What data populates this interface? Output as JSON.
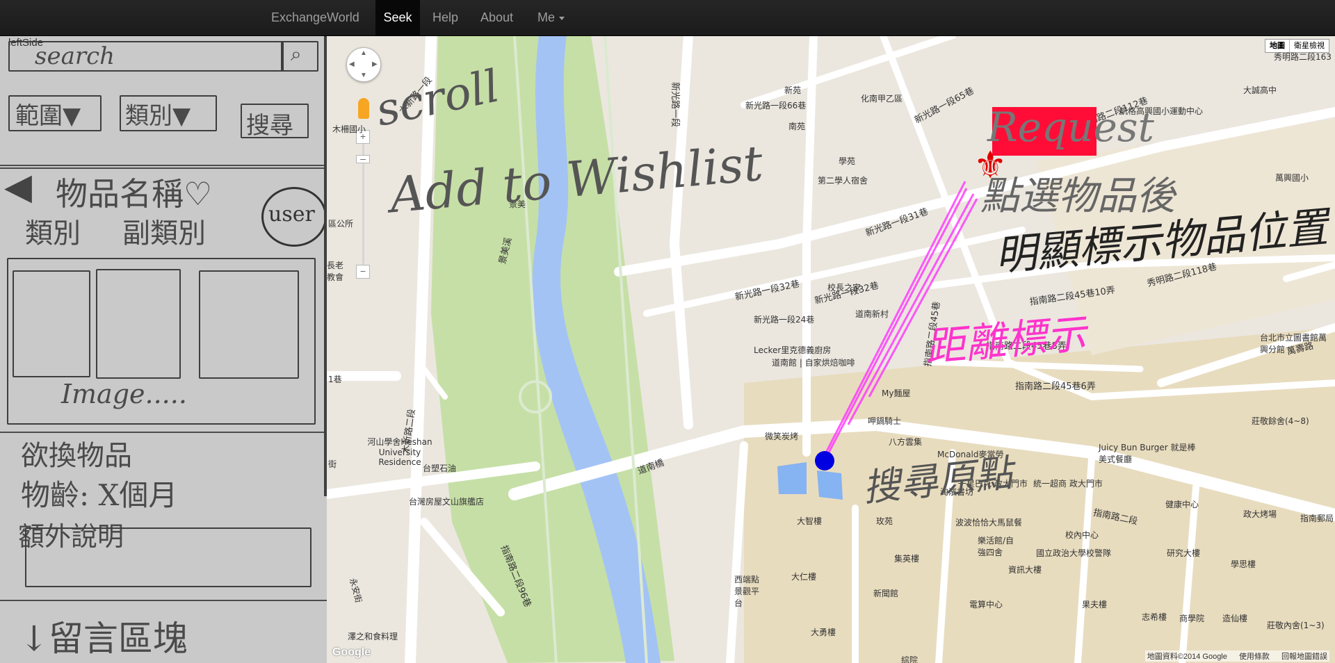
{
  "navbar": {
    "brand": "ExchangeWorld",
    "items": [
      "Seek",
      "Help",
      "About",
      "Me"
    ],
    "active": "Seek"
  },
  "left_panel": {
    "label": "leftSide",
    "search_placeholder": "search",
    "filters": [
      "範圍▼",
      "類別▼",
      "搜尋"
    ],
    "item_name": "物品名稱♡",
    "category": "類別",
    "sub_category": "副類別",
    "user": "user",
    "images_label": "Image.....",
    "want_label": "欲換物品",
    "age_label": "物齡: X個月",
    "extra_label": "額外說明",
    "comment_label": "↓留言區塊"
  },
  "map": {
    "map_type": [
      "地圖",
      "衛星檢視"
    ],
    "attribution": [
      "地圖資料©2014 Google",
      "使用條款",
      "回報地圖錯誤"
    ],
    "logo": "Google",
    "places": [
      "新光路一段65巷",
      "新光路一段66巷",
      "化南甲乙區",
      "南苑",
      "新苑",
      "第二學人宿舍",
      "學苑",
      "新光路一段31巷",
      "新光路一段32巷",
      "新光路一段24巷",
      "校長之家",
      "道南新村",
      "Lecker里克德義廚房",
      "道南館 | 自家烘焙咖啡",
      "My麵屋",
      "呷鍋騎士",
      "八方雲集",
      "McDonald麥當勞",
      "微笑炭烤",
      "道南橋",
      "河山學舍Heshan University Residence",
      "台塑石油",
      "台灣房屋文山旗艦店",
      "指南路二段96巷",
      "永安街",
      "澤之和食料理",
      "大智樓",
      "玫苑",
      "集英樓",
      "大仁樓",
      "新聞館",
      "西端點景觀平台",
      "大勇樓",
      "綜院",
      "資訊大樓",
      "電算中心",
      "果夫樓",
      "志希樓",
      "商學院",
      "造仙樓",
      "研究大樓",
      "學思樓",
      "政大烤場",
      "指南郵局",
      "健康中心",
      "國立政治大學校警隊",
      "樂活館/自強四舍",
      "波波恰恰大馬鼠餐",
      "統一超商 政大門市",
      "一星巴克 政大門市",
      "Juicy Bun Burger 就是棒美式餐廳",
      "莊敬餘舍(4~8)",
      "台北市立圖書館萬興分館",
      "萬壽路",
      "萬興國小",
      "凱格高興國小運動中心",
      "大誠高中",
      "秀明路二段163",
      "秀明路二段118巷",
      "秀明路二段112巷",
      "指南路二段45巷10弄",
      "指南路二段45巷8弄",
      "指南路二段45巷6弄",
      "指南路二段45巷",
      "指南路二段",
      "景美",
      "木柵國小",
      "區公所",
      "長老教會",
      "木新路一段",
      "木新路二段",
      "新光路一段32巷",
      "新光路一段",
      "景美溪",
      "莊敬內舍(1~3)",
      "淘濱書坊",
      "校內中心",
      "1巷",
      "街"
    ]
  },
  "annotations": {
    "scroll": "scroll",
    "add_to_wishlist": "Add to Wishlist",
    "request": "Request",
    "highlight_note_1": "點選物品後",
    "highlight_note_2": "明顯標示物品位置",
    "distance": "距離標示",
    "search_origin": "搜尋原點"
  }
}
